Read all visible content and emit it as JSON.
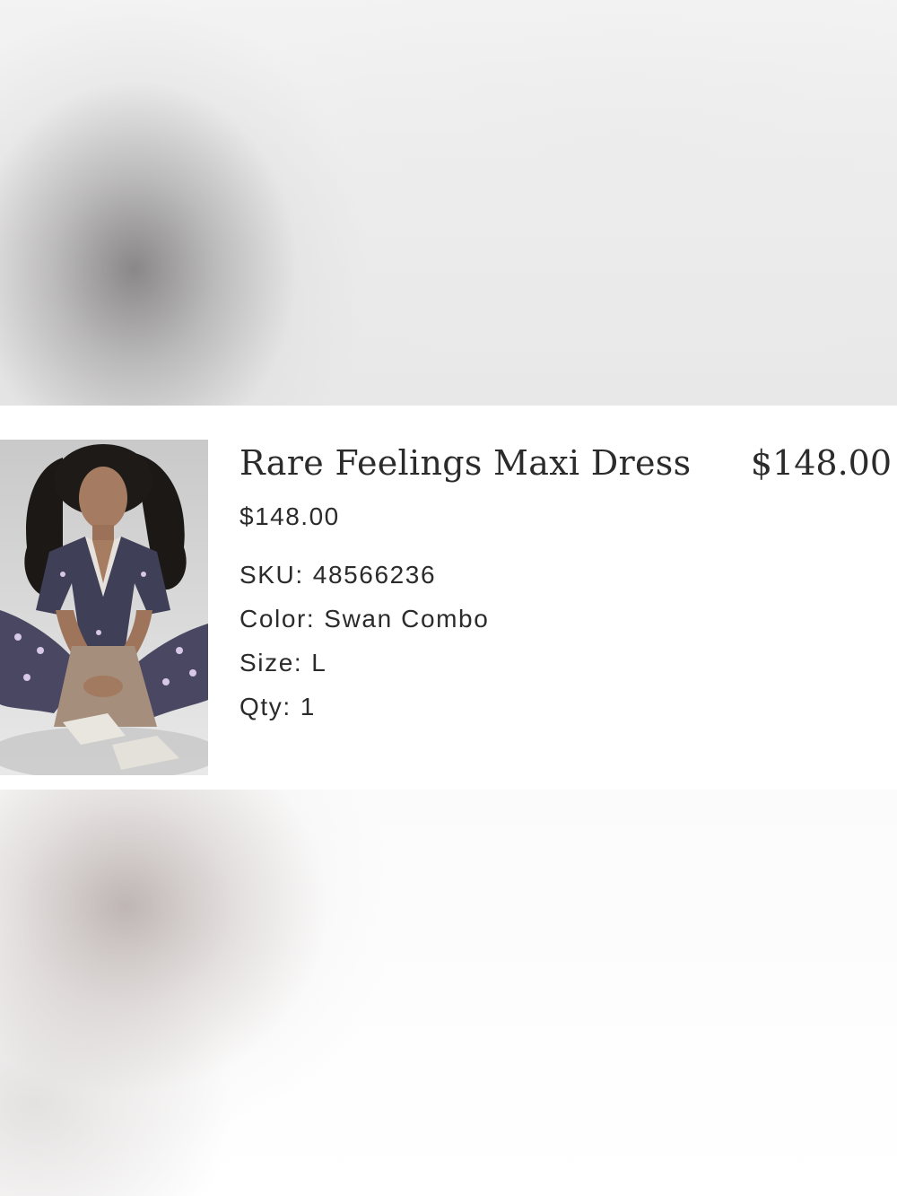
{
  "product": {
    "name": "Rare Feelings Maxi Dress",
    "line_total": "$148.00",
    "unit_price": "$148.00",
    "image_alt": "Model in Swan Combo printed maxi dress sitting on floor",
    "attributes": [
      {
        "label": "SKU:",
        "value": "48566236"
      },
      {
        "label": "Color:",
        "value": "Swan Combo"
      },
      {
        "label": "Size:",
        "value": "L"
      },
      {
        "label": "Qty:",
        "value": "1"
      }
    ]
  },
  "colors": {
    "text": "#2b2b2b",
    "background": "#ffffff"
  }
}
